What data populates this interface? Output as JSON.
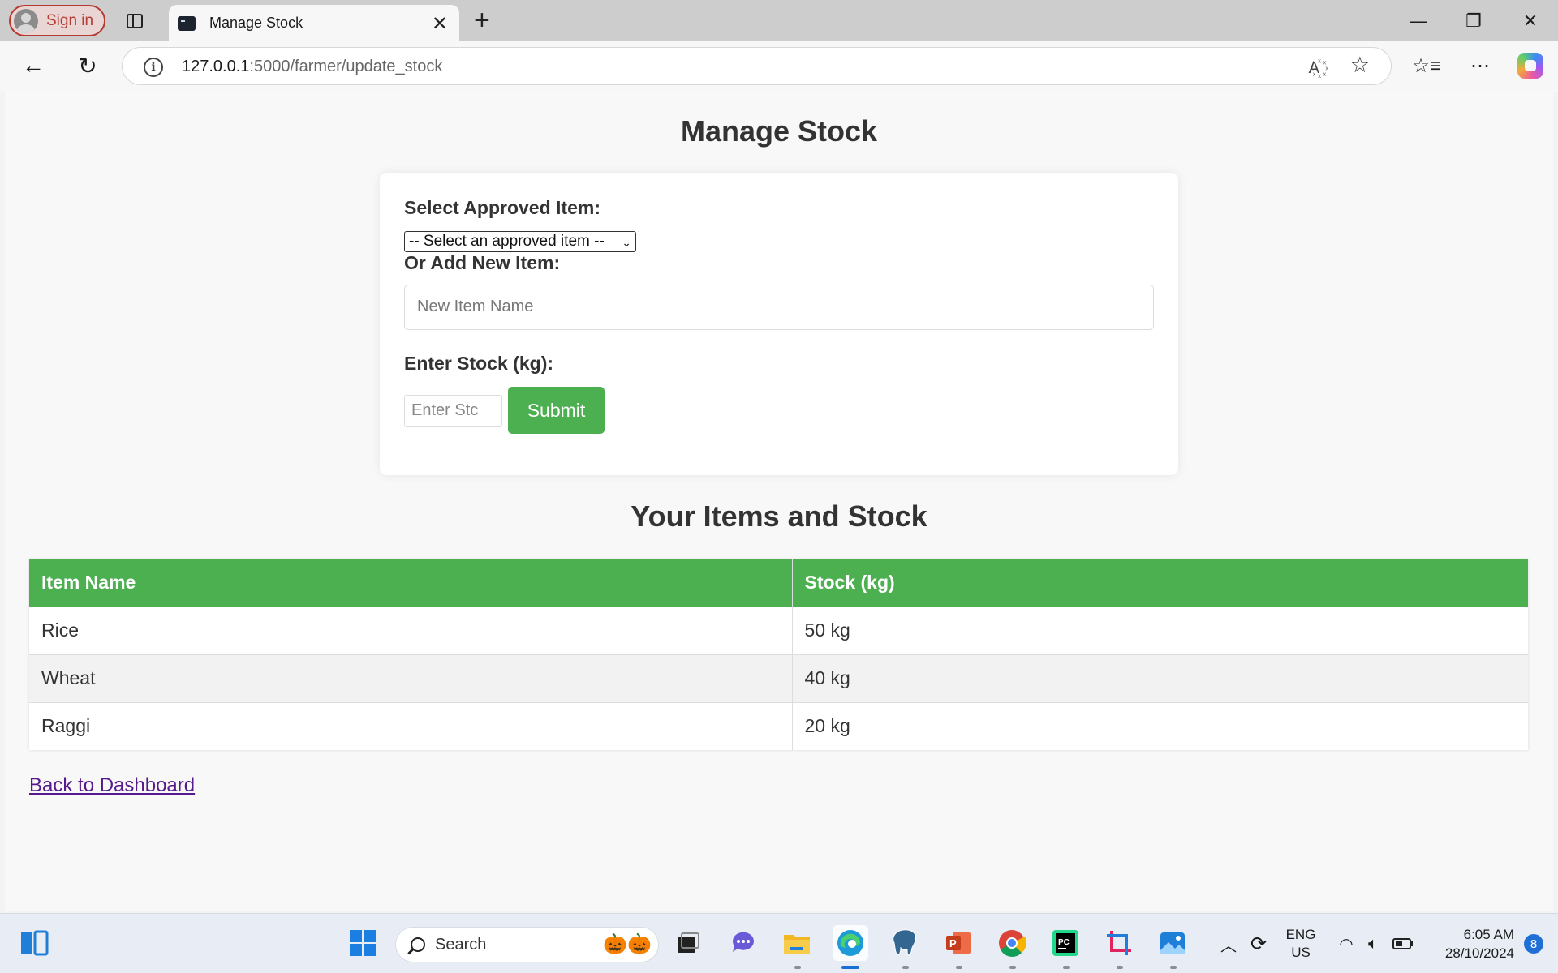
{
  "browser": {
    "signin_label": "Sign in",
    "tab_title": "Manage Stock",
    "url_host": "127.0.0.1",
    "url_path": ":5000/farmer/update_stock"
  },
  "page": {
    "title": "Manage Stock",
    "form": {
      "select_label": "Select Approved Item:",
      "select_value": "-- Select an approved item --",
      "new_item_label": "Or Add New Item:",
      "new_item_placeholder": "New Item Name",
      "stock_label": "Enter Stock (kg):",
      "stock_placeholder": "Enter Stc",
      "submit_label": "Submit"
    },
    "section_title": "Your Items and Stock",
    "table": {
      "headers": [
        "Item Name",
        "Stock (kg)"
      ],
      "rows": [
        [
          "Rice",
          "50 kg"
        ],
        [
          "Wheat",
          "40 kg"
        ],
        [
          "Raggi",
          "20 kg"
        ]
      ]
    },
    "back_link": "Back to Dashboard"
  },
  "taskbar": {
    "search_label": "Search",
    "lang_top": "ENG",
    "lang_bottom": "US",
    "time": "6:05 AM",
    "date": "28/10/2024",
    "notification_count": "8"
  },
  "colors": {
    "accent_green": "#4caf50",
    "link_purple": "#551a8b"
  }
}
